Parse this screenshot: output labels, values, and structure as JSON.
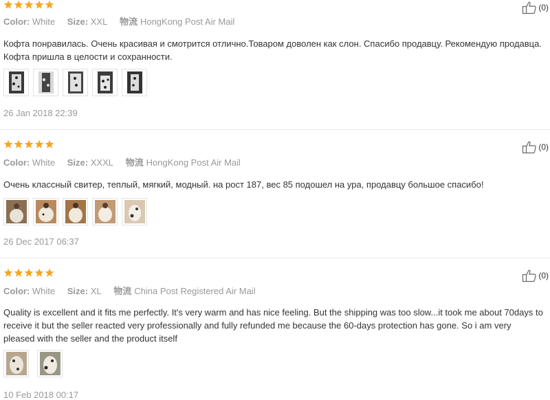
{
  "colors": {
    "star": "#f5a623",
    "muted": "#999999",
    "text": "#333333",
    "divider": "#e8e8e8"
  },
  "icons": {
    "rating": "star-icon",
    "helpful": "thumbs-up-icon"
  },
  "reviews": [
    {
      "rating": 5,
      "color_label": "Color:",
      "color_value": "White",
      "size_label": "Size:",
      "size_value": "XXL",
      "logistics_label": "物流",
      "logistics_value": "HongKong Post Air Mail",
      "helpful": "(0)",
      "text": "Кофта понравилась. Очень красивая и смотрится отлично.Товаром доволен как слон. Спасибо продавцу. Рекомендую продавца. Кофта пришла в целости и сохранности.",
      "photos": 5,
      "photo_style": "dark",
      "date": "26 Jan 2018 22:39"
    },
    {
      "rating": 5,
      "color_label": "Color:",
      "color_value": "White",
      "size_label": "Size:",
      "size_value": "XXXL",
      "logistics_label": "物流",
      "logistics_value": "HongKong Post Air Mail",
      "helpful": "(0)",
      "text": "Очень классный свитер, теплый, мягкий, модный. на рост 187, вес 85 подошел на ура, продавцу большое спасибо!",
      "photos": 5,
      "photo_style": "brown",
      "date": "26 Dec 2017 06:37"
    },
    {
      "rating": 5,
      "color_label": "Color:",
      "color_value": "White",
      "size_label": "Size:",
      "size_value": "XL",
      "logistics_label": "物流",
      "logistics_value": "China Post Registered Air Mail",
      "helpful": "(0)",
      "text": "Quality is excellent and it fits me perfectly. It's very warm and has nice feeling. But the shipping was too slow...it took me about 70days to receive it but the seller reacted very professionally and fully refunded me because the 60-days protection has gone. So i am very pleased with the seller and the product itself",
      "photos": 2,
      "photo_style": "light",
      "date": "10 Feb 2018 00:17"
    }
  ]
}
